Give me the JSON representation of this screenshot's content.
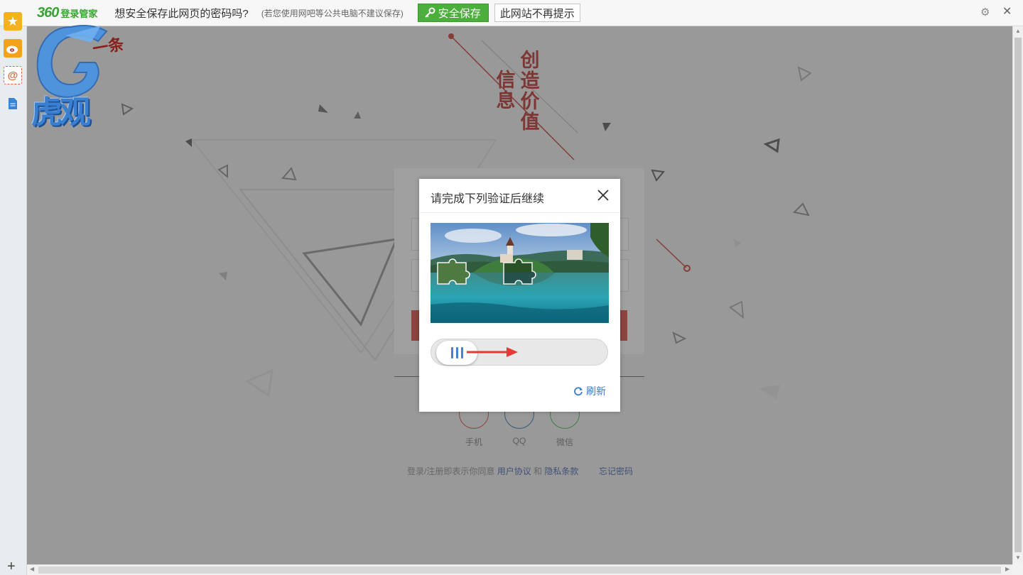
{
  "password_bar": {
    "brand_number": "360",
    "brand_text": "登录管家",
    "question": "想安全保存此网页的密码吗?",
    "hint": "(若您使用网吧等公共电脑不建议保存)",
    "save_label": "安全保存",
    "never_label": "此网站不再提示",
    "accent": "#4cae3c"
  },
  "sidebar": {
    "items": [
      "star-icon",
      "weibo-icon",
      "mail-icon",
      "doc-icon"
    ],
    "add_label": "+"
  },
  "page": {
    "tagline_col1": "信息",
    "tagline_col2": "创造价值",
    "tagline_partial": "一条",
    "brand_color": "#b52a24",
    "social": [
      {
        "label": "手机",
        "color": "#d7443a"
      },
      {
        "label": "QQ",
        "color": "#1f6fb5"
      },
      {
        "label": "微信",
        "color": "#3bb54a"
      }
    ],
    "agree_prefix": "登录/注册即表示你同意",
    "agree_link1": "用户协议",
    "agree_and": "和",
    "agree_link2": "隐私条款",
    "forgot": "忘记密码"
  },
  "captcha": {
    "title": "请完成下列验证后继续",
    "refresh_label": "刷新",
    "slider_progress": 0
  },
  "watermark": {
    "text": "虎观"
  }
}
